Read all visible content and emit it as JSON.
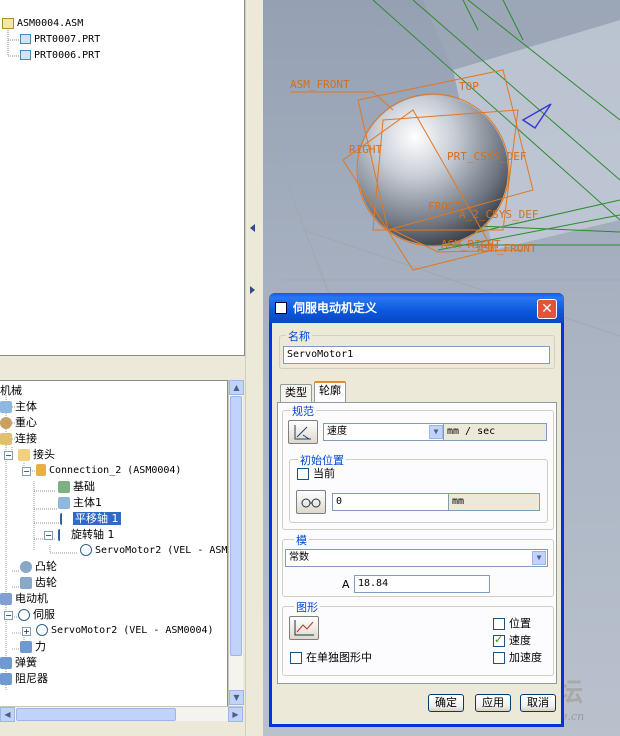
{
  "model_tree": {
    "items": [
      {
        "label": "ASM0004.ASM"
      },
      {
        "label": "PRT0007.PRT"
      },
      {
        "label": "PRT0006.PRT"
      }
    ]
  },
  "mech_tree": {
    "items": {
      "mechanism": "机械",
      "bodies": "主体",
      "gravity": "重心",
      "connections": "连接",
      "joints": "接头",
      "connection2": "Connection_2 (ASM0004)",
      "base": "基础",
      "body1": "主体1",
      "translation_axis": "平移轴 1",
      "rotation_axis": "旋转轴 1",
      "servo_motor_sub": "ServoMotor2 (VEL - ASM",
      "cams": "凸轮",
      "gears": "齿轮",
      "motors": "电动机",
      "servos": "伺服",
      "servo_motor": "ServoMotor2 (VEL - ASM0004)",
      "forces": "力",
      "springs": "弹簧",
      "dampers": "阻尼器"
    }
  },
  "graphics": {
    "labels": {
      "asm_front": "ASM_FRONT",
      "top": "TOP",
      "right": "RIGHT",
      "csys1": "PRT_CSYS_DEF",
      "front": "FRONT",
      "csys2": "A_2_CSYS_DEF",
      "asm_right": "ASM_RIGHT",
      "front2": "ASM_FRONT"
    },
    "watermark_title": "野火论坛",
    "watermark_url": "www.proewildfire.cn"
  },
  "dialog": {
    "title": "伺服电动机定义",
    "name_section": "名称",
    "name_value": "ServoMotor1",
    "tabs": [
      {
        "label": "类型"
      },
      {
        "label": "轮廓"
      }
    ],
    "spec_section": "规范",
    "spec_value": "速度",
    "spec_unit": "mm / sec",
    "initial_pos_section": "初始位置",
    "current_label": "当前",
    "initial_value": "0",
    "initial_unit": "mm",
    "model_section": "模",
    "model_value": "常数",
    "a_label": "A",
    "a_value": "18.84",
    "graph_section": "图形",
    "position_label": "位置",
    "velocity_label": "速度",
    "acceleration_label": "加速度",
    "separate_graph_label": "在单独图形中",
    "ok_label": "确定",
    "apply_label": "应用",
    "cancel_label": "取消",
    "checks": {
      "position": false,
      "velocity": true,
      "acceleration": false,
      "current": false,
      "separate": false
    }
  }
}
